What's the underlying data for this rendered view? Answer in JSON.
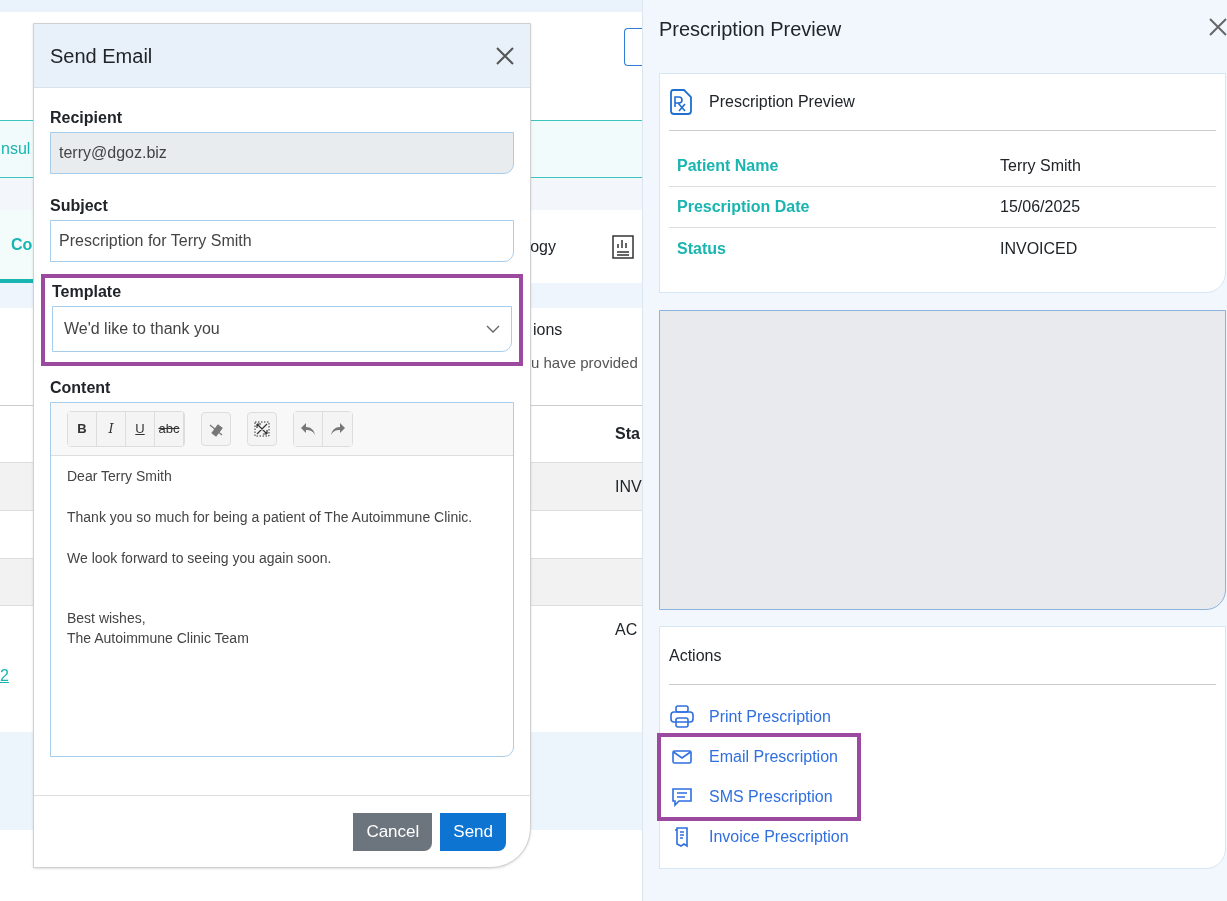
{
  "background": {
    "banner_text": "nsul",
    "tab_text": "Co",
    "tab_text_2": "ogy",
    "section_title": "ions",
    "section_text": "u have provided",
    "column_header": "Sta",
    "cells": [
      "INV",
      "AC"
    ],
    "link": "2"
  },
  "modal": {
    "title": "Send Email",
    "recipient": {
      "label": "Recipient",
      "value": "terry@dgoz.biz",
      "disabled": true
    },
    "subject": {
      "label": "Subject",
      "value": "Prescription for Terry Smith",
      "disabled": false
    },
    "template": {
      "label": "Template",
      "value": "We'd like to thank you",
      "highlighted": true
    },
    "content": {
      "label": "Content",
      "format_buttons": [
        "B",
        "I",
        "U",
        "abc"
      ],
      "paragraphs": [
        "Dear Terry Smith",
        "Thank you so much for being a patient of The Autoimmune Clinic.",
        "We look forward to seeing you again soon."
      ],
      "signature": [
        "Best wishes,",
        "The Autoimmune Clinic Team"
      ]
    },
    "buttons": [
      {
        "label": "Cancel",
        "kind": "secondary"
      },
      {
        "label": "Send",
        "kind": "primary"
      }
    ]
  },
  "panel": {
    "title": "Prescription Preview",
    "card_title": "Prescription Preview",
    "fields": [
      {
        "label": "Patient Name",
        "value": "Terry Smith"
      },
      {
        "label": "Prescription Date",
        "value": "15/06/2025"
      },
      {
        "label": "Status",
        "value": "INVOICED"
      }
    ],
    "actions_title": "Actions",
    "action_groups": [
      {
        "highlighted": false,
        "items": [
          {
            "kind": "print",
            "label": "Print Prescription"
          }
        ]
      },
      {
        "highlighted": true,
        "items": [
          {
            "kind": "email",
            "label": "Email Prescription"
          },
          {
            "kind": "sms",
            "label": "SMS Prescription"
          }
        ]
      },
      {
        "highlighted": false,
        "items": [
          {
            "kind": "invoice",
            "label": "Invoice Prescription"
          }
        ]
      }
    ]
  }
}
